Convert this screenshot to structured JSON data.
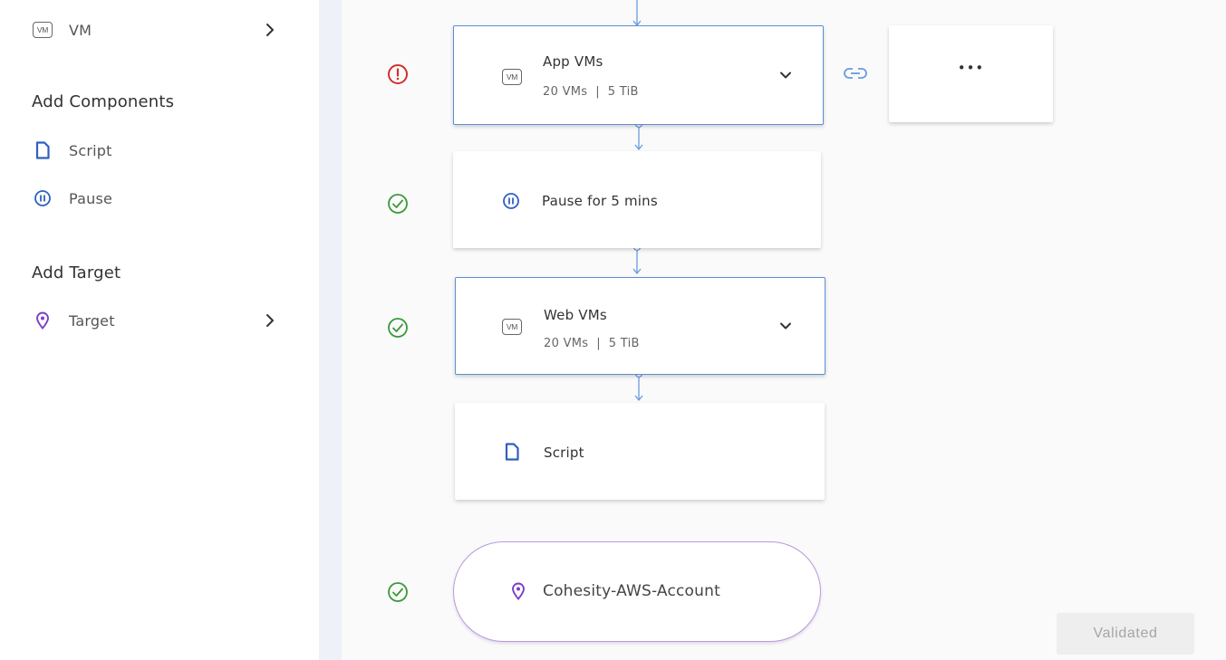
{
  "sidebar": {
    "vm_item": {
      "label": "VM",
      "badge": "VM"
    },
    "add_components": {
      "heading": "Add Components",
      "items": [
        {
          "label": "Script",
          "icon": "document-icon"
        },
        {
          "label": "Pause",
          "icon": "pause-icon"
        }
      ]
    },
    "add_target": {
      "heading": "Add Target",
      "items": [
        {
          "label": "Target",
          "icon": "location-pin-icon"
        }
      ]
    }
  },
  "flow": {
    "nodes": [
      {
        "type": "vm-group",
        "title": "App VMs",
        "vm_count": "20 VMs",
        "size": "5 TiB",
        "separator": "|",
        "status": "error",
        "badge": "VM"
      },
      {
        "type": "pause",
        "title": "Pause for 5 mins",
        "status": "ok"
      },
      {
        "type": "vm-group",
        "title": "Web VMs",
        "vm_count": "20 VMs",
        "size": "5 TiB",
        "separator": "|",
        "status": "ok",
        "badge": "VM"
      },
      {
        "type": "script",
        "title": "Script"
      },
      {
        "type": "target",
        "title": "Cohesity-AWS-Account",
        "status": "ok"
      }
    ],
    "more_button_label": "•••"
  },
  "footer": {
    "validated_label": "Validated"
  },
  "colors": {
    "accent_blue": "#3b6fd1",
    "error_red": "#d0312d",
    "success_green": "#3a9a3a",
    "target_purple": "#7b3fc4",
    "connector": "#6b9ae0"
  }
}
